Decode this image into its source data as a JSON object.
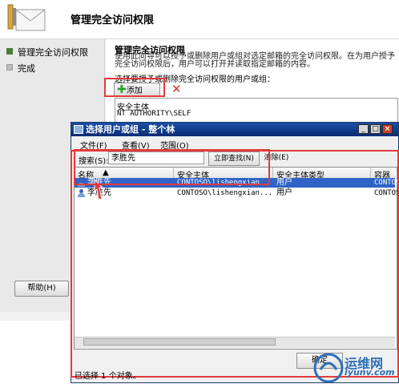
{
  "wizard": {
    "title": "管理完全访问权限",
    "steps": [
      {
        "label": "管理完全访问权限",
        "current": true
      },
      {
        "label": "完成",
        "current": false
      }
    ],
    "help_button": "帮助(H)",
    "section_title": "管理完全访问权限",
    "description": "使用此向导可以授予或删除用户或组对选定邮箱的完全访问权限。在为用户授予完全访问权限后，用户可以打开并读取指定邮箱的内容。",
    "list_label": "选择要授予或删除完全访问权限的用户或组：",
    "add_button": "添加(D)...",
    "list_header": "安全主体",
    "list_rows": [
      "NT AUTHORITY\\SELF"
    ]
  },
  "dialog": {
    "title": "选择用户或组 - 整个林",
    "menu": [
      "文件(F)",
      "查看(V)",
      "范围(O)"
    ],
    "search_label": "搜索(S):",
    "search_value": "李胜先",
    "find_now_button": "立即查找(N)",
    "clear_button": "清除(E)",
    "columns": [
      "名称",
      "安全主体",
      "安全主体类型",
      "容器"
    ],
    "rows": [
      {
        "name": "李胜先",
        "principal": "CONTOSO\\lishengxian",
        "type": "用户",
        "container": "CONTOS",
        "selected": true
      },
      {
        "name": "李胜先",
        "principal": "CONTOSO\\lishengxian...",
        "type": "用户",
        "container": "CONTOS",
        "selected": false
      }
    ],
    "ok_button": "确定",
    "status": "已选择 1 个对象。"
  },
  "watermark": {
    "text": "运维网",
    "url": "iyunv.com"
  },
  "colors": {
    "highlight_red": "#e23a3a",
    "title_blue": "#1b4fa5",
    "selection_blue": "#2f63c6"
  }
}
